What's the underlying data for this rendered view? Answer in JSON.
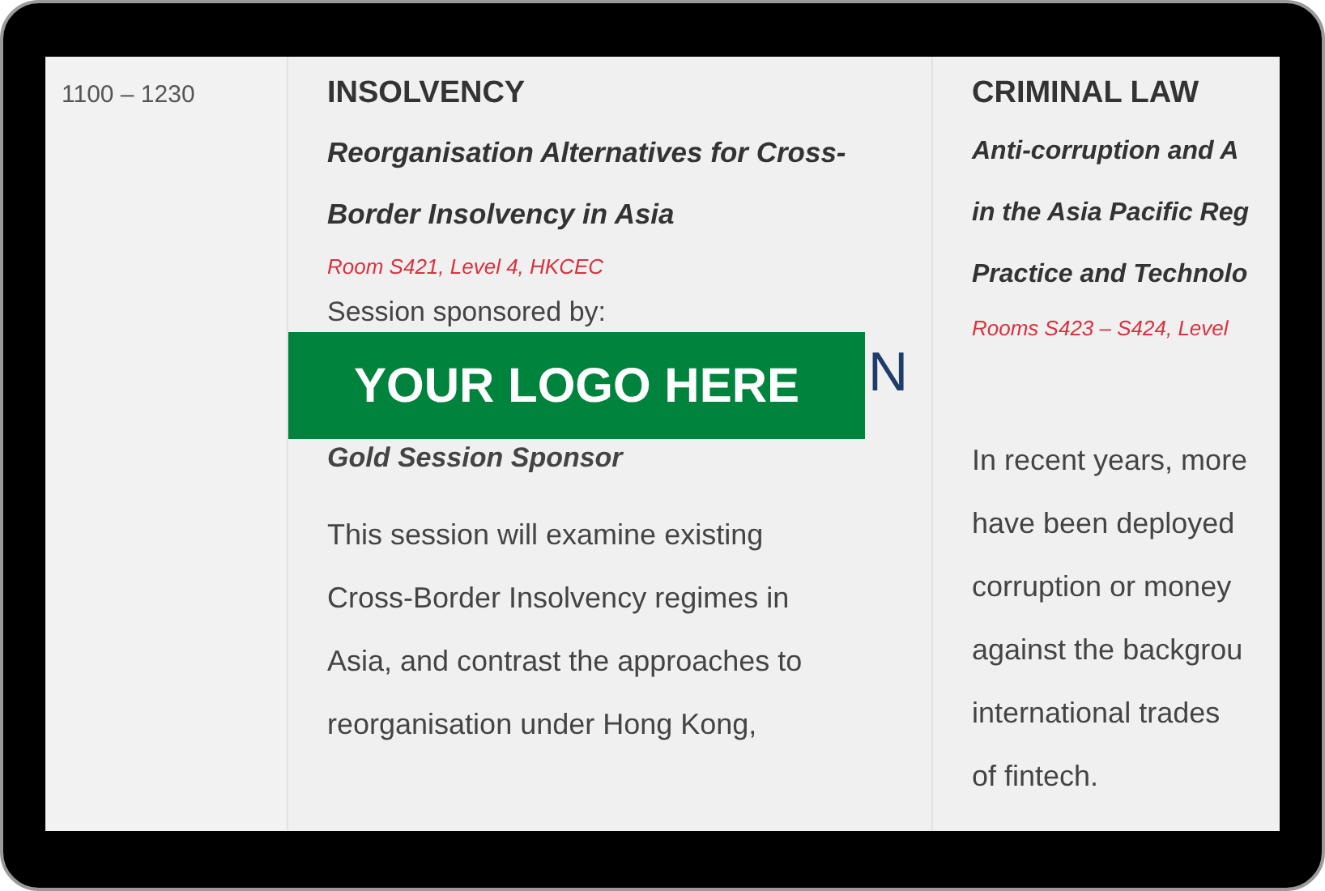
{
  "time_slot": "1100 – 1230",
  "sessions": [
    {
      "category": "INSOLVENCY",
      "title_lines": [
        "Reorganisation Alternatives for Cross-",
        "Border Insolvency in Asia"
      ],
      "venue": "Room S421, Level 4, HKCEC",
      "sponsor_label": "Session sponsored by:",
      "sponsor_logo_fragment": "N",
      "logo_badge": "YOUR LOGO HERE",
      "sponsor_tier": "Gold Session Sponsor",
      "description_lines": [
        "This session will examine existing",
        "Cross-Border Insolvency regimes in",
        "Asia, and contrast the approaches to",
        "reorganisation under Hong Kong,"
      ]
    },
    {
      "category": "CRIMINAL LAW",
      "title_lines": [
        "Anti-corruption and A",
        "in the Asia Pacific Reg",
        "Practice and Technolo"
      ],
      "venue": "Rooms S423 – S424, Level",
      "description_lines": [
        "In recent years, more",
        "have been deployed",
        "corruption or money",
        "against the backgrou",
        "international trades",
        "of fintech."
      ]
    }
  ]
}
